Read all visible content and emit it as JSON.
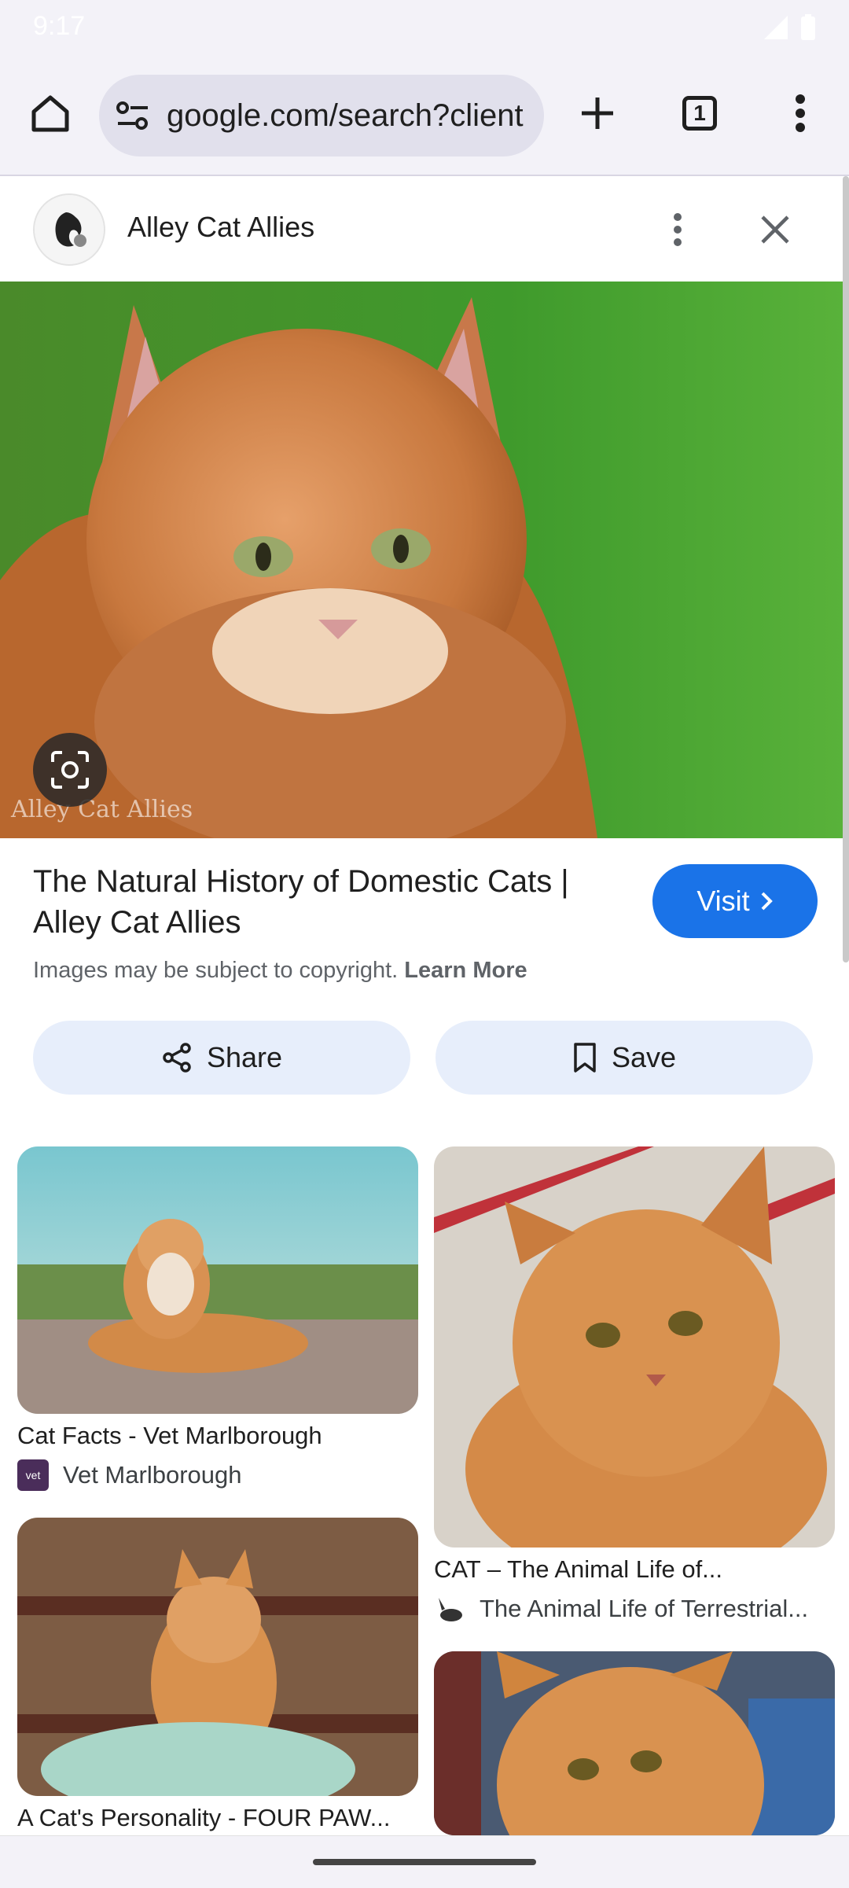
{
  "status": {
    "time": "9:17"
  },
  "browser": {
    "url": "google.com/search?client",
    "tab_count": "1"
  },
  "panel": {
    "site_name": "Alley Cat Allies",
    "watermark": "Alley Cat Allies",
    "result_title": "The Natural History of Domestic Cats | Alley Cat Allies",
    "visit_label": "Visit",
    "copyright_text": "Images may be subject to copyright.",
    "learn_more": "Learn More",
    "share_label": "Share",
    "save_label": "Save"
  },
  "related": [
    {
      "title": "Cat Facts - Vet Marlborough",
      "source": "Vet Marlborough",
      "favicon_text": "vet"
    },
    {
      "title": "CAT – The Animal Life of...",
      "source": "The Animal Life of Terrestrial..."
    },
    {
      "title": "A Cat's Personality - FOUR PAW..."
    }
  ],
  "colors": {
    "accent": "#1a73e8",
    "toolbar_bg": "#f3f2f8",
    "chip_bg": "#e7eefb"
  }
}
